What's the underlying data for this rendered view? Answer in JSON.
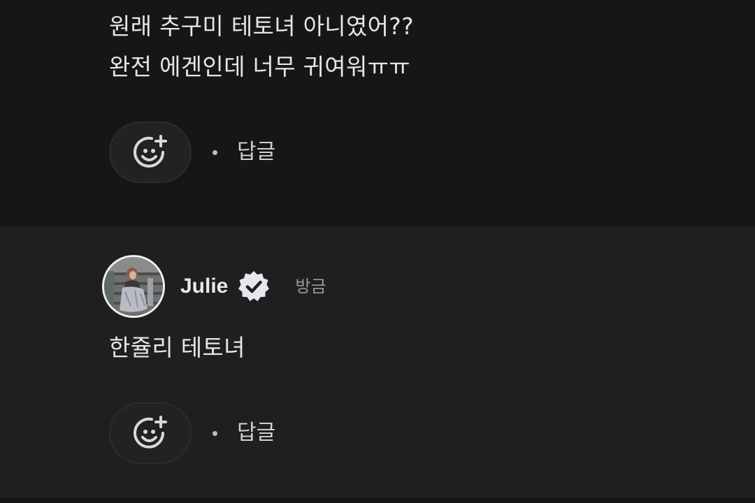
{
  "comments": [
    {
      "lines": [
        "원래 추구미 테토녀 아니였어??",
        "완전 에겐인데 너무 귀여워ㅠㅠ"
      ],
      "reply_label": "답글",
      "reaction_icon": "add-reaction-icon"
    },
    {
      "author": "Julie",
      "verified_icon": "verified-badge-icon",
      "timestamp": "방금",
      "avatar_icon": "user-avatar",
      "lines": [
        "한쥴리 테토녀"
      ],
      "reply_label": "답글",
      "reaction_icon": "add-reaction-icon"
    }
  ],
  "colors": {
    "page_background": "#1d1d1d",
    "comment_background_previous": "#161616",
    "comment_background_current": "#1f1f1f",
    "text_primary": "#e6e6e6",
    "text_secondary": "#9a9a9a",
    "pill_background": "#222222"
  }
}
